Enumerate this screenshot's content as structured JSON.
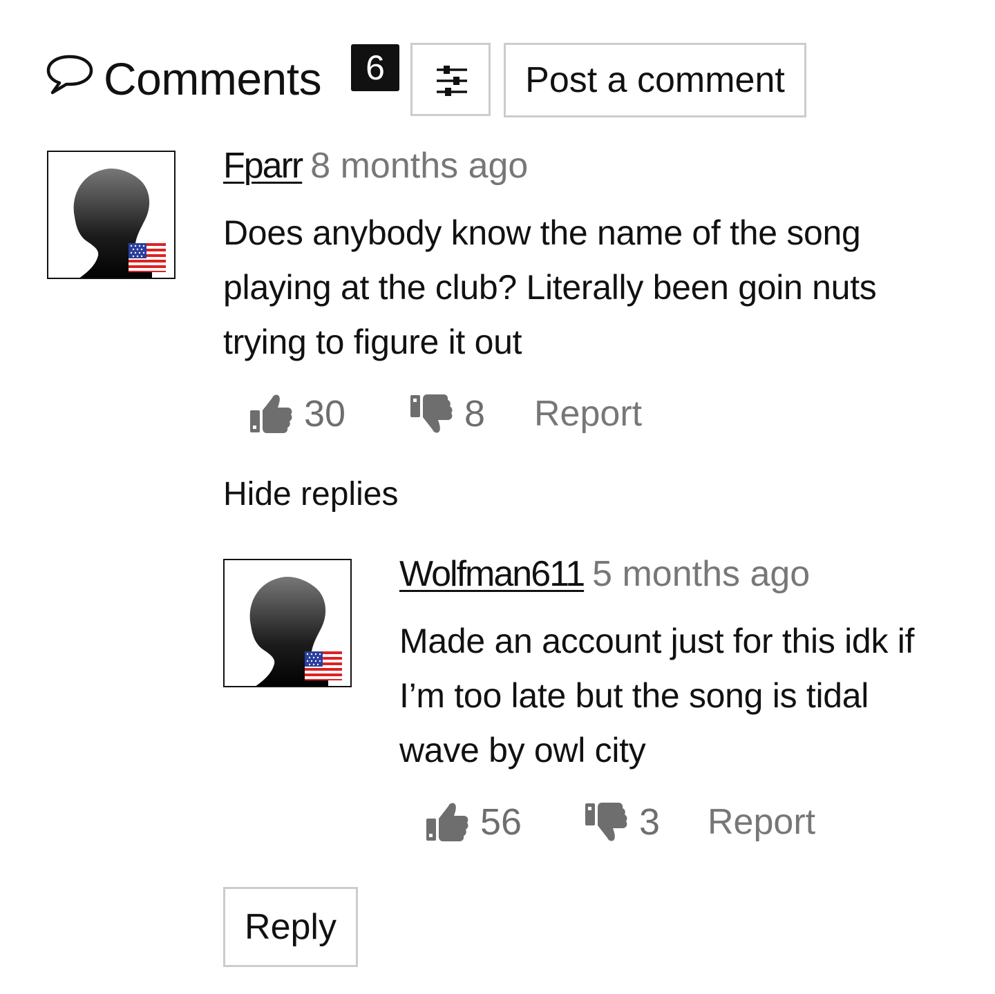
{
  "header": {
    "title": "Comments",
    "count": "6",
    "filter_icon": "sliders-icon",
    "post_label": "Post a comment"
  },
  "comments": [
    {
      "author": "Fparr",
      "time": "8 months ago",
      "body": "Does anybody know the name of the song playing at the club? Literally been goin nuts trying to figure it out",
      "likes": "30",
      "dislikes": "8",
      "report_label": "Report",
      "flag": "us-flag-icon"
    }
  ],
  "thread": {
    "hide_replies_label": "Hide replies",
    "reply_label": "Reply"
  },
  "replies": [
    {
      "author": "Wolfman611",
      "time": "5 months ago",
      "body": "Made an account just for this idk if I’m too late but the song is tidal wave by owl city",
      "likes": "56",
      "dislikes": "3",
      "report_label": "Report",
      "flag": "us-flag-icon"
    }
  ],
  "colors": {
    "text": "#111111",
    "muted": "#777777",
    "border": "#cccccc",
    "badge_bg": "#111111"
  }
}
